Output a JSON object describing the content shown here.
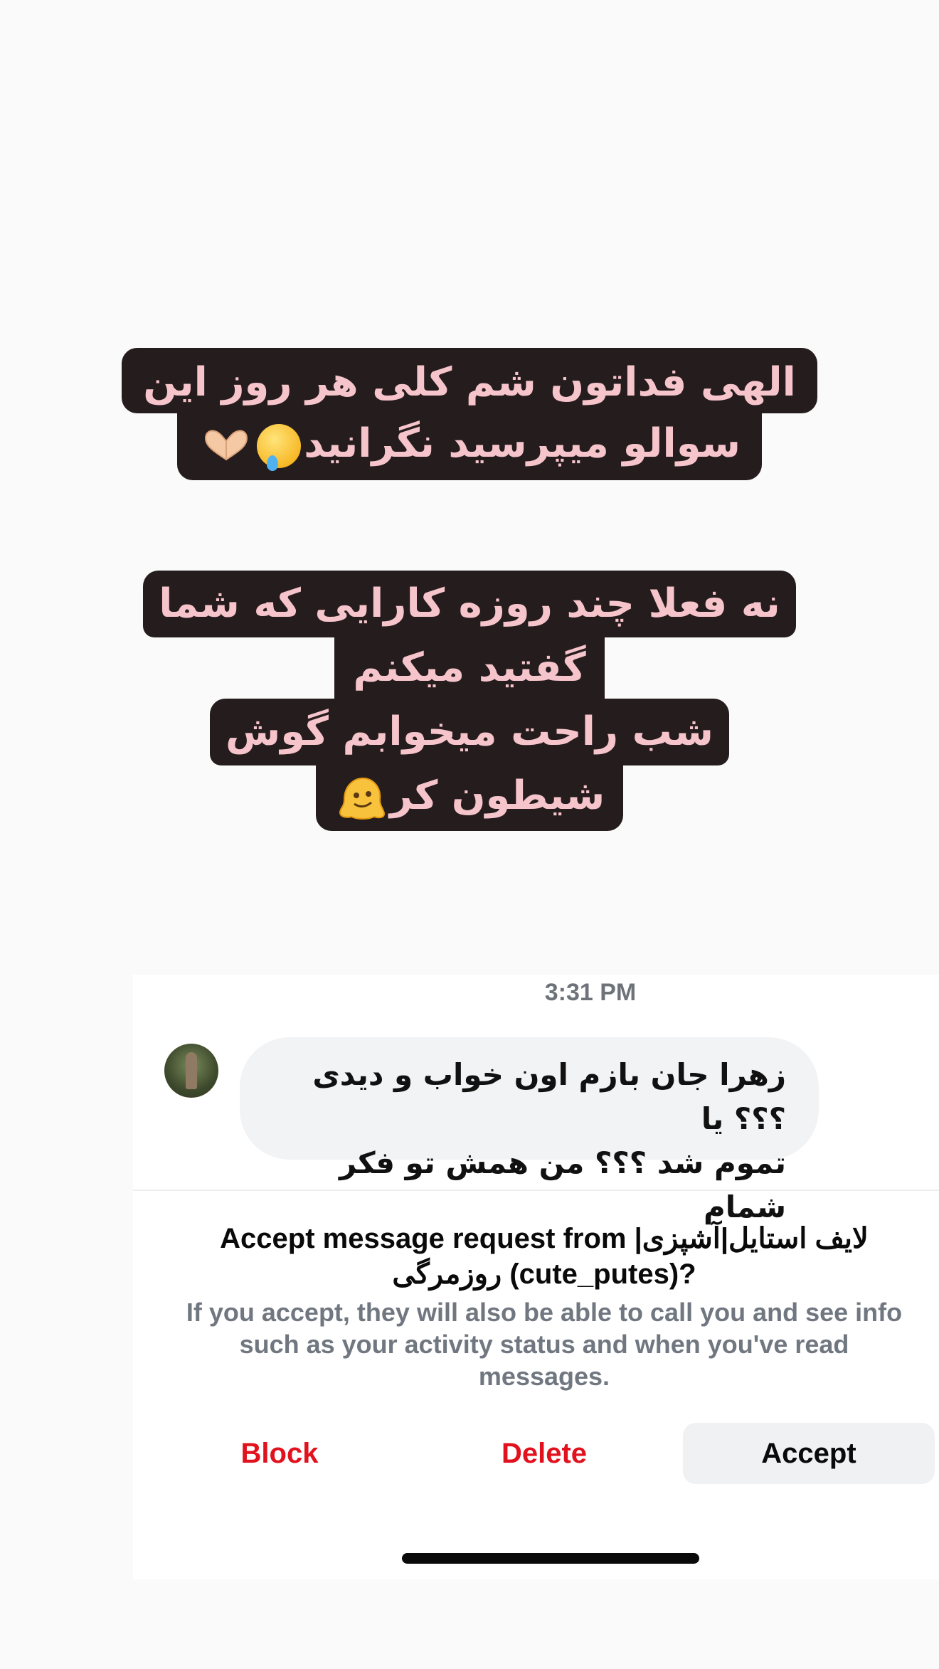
{
  "story": {
    "caption_1": {
      "line_1": "الهی فداتون شم کلی هر روز این",
      "line_2": "سوالو میپرسید نگرانید"
    },
    "caption_2": {
      "line_1": "نه فعلا چند روزه کارایی که شما",
      "line_2": "گفتید میکنم",
      "line_3": "شب راحت میخوابم گوش",
      "line_4": "شیطون کر"
    },
    "emoji": {
      "crying_face": "face-holding-back-tears-icon",
      "heart_hands": "heart-hands-icon",
      "melting_face": "melting-face-icon"
    },
    "caption_text_color": "#f6c4cb",
    "caption_background": "#251c1d"
  },
  "chat": {
    "timestamp": "3:31 PM",
    "message": {
      "line_1": "زهرا جان بازم اون خواب و دیدی ؟؟؟ یا",
      "line_2": "تموم شد ؟؟؟ من همش تو فکر شمام"
    }
  },
  "request": {
    "title": "Accept message request from لایف استایل|آشپزی| روزمرگی (cute_putes)?",
    "description": "If you accept, they will also be able to call you and see info such as your activity status and when you've read messages.",
    "block_label": "Block",
    "delete_label": "Delete",
    "accept_label": "Accept",
    "destructive_color": "#e1121d"
  }
}
